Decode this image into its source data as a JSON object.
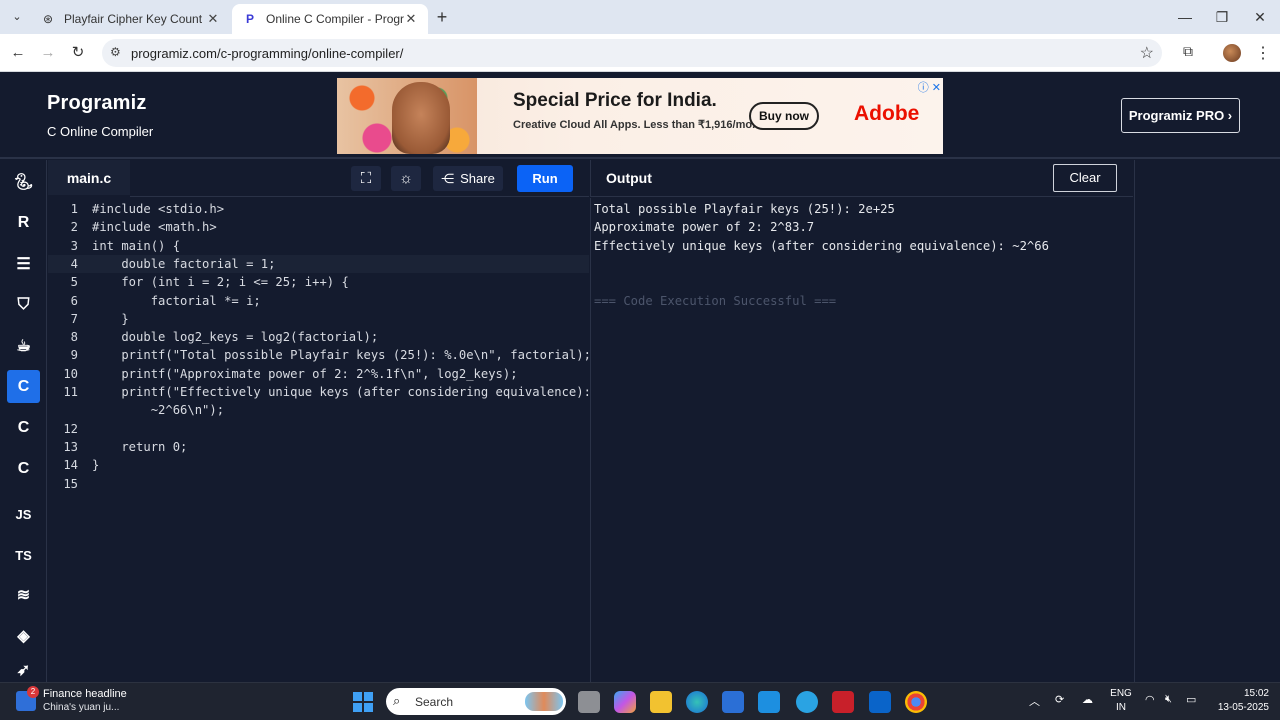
{
  "browser": {
    "tabs": [
      {
        "title": "Playfair Cipher Key Count",
        "favicon": "chatgpt-icon"
      },
      {
        "title": "Online C Compiler - Programiz",
        "favicon": "programiz-icon"
      }
    ],
    "url": "programiz.com/c-programming/online-compiler/"
  },
  "header": {
    "logo_text": "Programiz",
    "subtitle": "C Online Compiler",
    "pro_button": "Programiz PRO ›"
  },
  "ad": {
    "headline": "Special Price for India.",
    "subline": "Creative Cloud All Apps. Less than ₹1,916/mo.",
    "button": "Buy now",
    "brand": "Adobe"
  },
  "sidebar": {
    "items": [
      {
        "name": "python",
        "label": "",
        "icon": "python-icon"
      },
      {
        "name": "r",
        "label": "R",
        "icon": "r-icon"
      },
      {
        "name": "sql",
        "label": "",
        "icon": "database-icon"
      },
      {
        "name": "html",
        "label": "",
        "icon": "html5-icon"
      },
      {
        "name": "java",
        "label": "",
        "icon": "java-icon"
      },
      {
        "name": "c",
        "label": "C",
        "icon": "c-icon",
        "active": true
      },
      {
        "name": "cpp",
        "label": "C",
        "icon": "cpp-icon"
      },
      {
        "name": "csharp",
        "label": "C",
        "icon": "csharp-icon"
      },
      {
        "name": "js",
        "label": "JS",
        "icon": "javascript-icon"
      },
      {
        "name": "ts",
        "label": "TS",
        "icon": "typescript-icon"
      },
      {
        "name": "go",
        "label": "",
        "icon": "go-icon"
      },
      {
        "name": "php",
        "label": "",
        "icon": "php-icon"
      },
      {
        "name": "swift",
        "label": "",
        "icon": "swift-icon"
      }
    ]
  },
  "editor": {
    "filename": "main.c",
    "share_label": "Share",
    "run_label": "Run",
    "lines": [
      {
        "n": "1",
        "code": "#include <stdio.h>"
      },
      {
        "n": "2",
        "code": "#include <math.h>"
      },
      {
        "n": "3",
        "code": "int main() {"
      },
      {
        "n": "4",
        "code": "    double factorial = 1;"
      },
      {
        "n": "5",
        "code": "    for (int i = 2; i <= 25; i++) {"
      },
      {
        "n": "6",
        "code": "        factorial *= i;"
      },
      {
        "n": "7",
        "code": "    }"
      },
      {
        "n": "8",
        "code": "    double log2_keys = log2(factorial);"
      },
      {
        "n": "9",
        "code": "    printf(\"Total possible Playfair keys (25!): %.0e\\n\", factorial);"
      },
      {
        "n": "10",
        "code": "    printf(\"Approximate power of 2: 2^%.1f\\n\", log2_keys);"
      },
      {
        "n": "11",
        "code": "    printf(\"Effectively unique keys (after considering equivalence):"
      },
      {
        "n": "",
        "code": "        ~2^66\\n\");"
      },
      {
        "n": "12",
        "code": ""
      },
      {
        "n": "13",
        "code": "    return 0;"
      },
      {
        "n": "14",
        "code": "}"
      },
      {
        "n": "15",
        "code": ""
      }
    ]
  },
  "output": {
    "title": "Output",
    "clear_label": "Clear",
    "lines": [
      "Total possible Playfair keys (25!): 2e+25",
      "Approximate power of 2: 2^83.7",
      "Effectively unique keys (after considering equivalence): ~2^66",
      "",
      "",
      "=== Code Execution Successful ==="
    ]
  },
  "taskbar": {
    "news_title": "Finance headline",
    "news_sub": "China's yuan ju...",
    "news_badge": "2",
    "search_label": "Search",
    "lang_line1": "ENG",
    "lang_line2": "IN",
    "time": "15:02",
    "date": "13-05-2025"
  }
}
